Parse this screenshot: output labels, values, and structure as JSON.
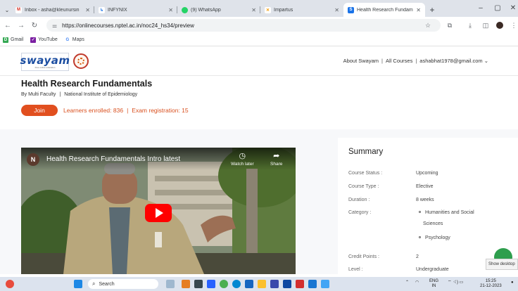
{
  "browser": {
    "tabs": [
      {
        "title": "Inbox - asha@kleunursin",
        "icon": "gmail-icon",
        "color": "#d93025",
        "glyph": "M"
      },
      {
        "title": "INFYNIX",
        "icon": "infynix-icon",
        "color": "#1a73e8",
        "glyph": "↳"
      },
      {
        "title": "(9) WhatsApp",
        "icon": "whatsapp-icon",
        "color": "#25d366",
        "glyph": "●"
      },
      {
        "title": "Impartus",
        "icon": "impartus-icon",
        "color": "#f4b400",
        "glyph": "✕"
      },
      {
        "title": "Health Research Fundam",
        "icon": "swayam-icon",
        "color": "#1a73e8",
        "glyph": "S",
        "active": true
      }
    ],
    "new_tab_label": "+",
    "url": "https://onlinecourses.nptel.ac.in/noc24_hs34/preview",
    "bookmarks": [
      {
        "label": "Gmail",
        "icon": "gmail-icon",
        "color": "#34a853",
        "glyph": "D"
      },
      {
        "label": "YouTube",
        "icon": "youtube-icon",
        "color": "#7b1fa2",
        "glyph": "✓"
      },
      {
        "label": "Maps",
        "icon": "maps-icon",
        "color": "#4285f4",
        "glyph": "G"
      }
    ]
  },
  "site": {
    "logo_text": "swayam",
    "logo_tagline": "Free online education",
    "nav": {
      "about": "About Swayam",
      "courses": "All Courses",
      "user": "ashabhat1978@gmail.com ⌄"
    }
  },
  "course": {
    "title": "Health Research Fundamentals",
    "faculty": "By Multi Faculty",
    "institute": "National Institute of Epidemiology",
    "join_label": "Join",
    "learners": "Learners enrolled: 836",
    "exam": "Exam registration: 15"
  },
  "video": {
    "channel_initial": "N",
    "title": "Health Research Fundamentals Intro latest",
    "watch_later": "Watch later",
    "share": "Share"
  },
  "summary": {
    "heading": "Summary",
    "rows": [
      {
        "label": "Course Status :",
        "value": "Upcoming"
      },
      {
        "label": "Course Type :",
        "value": "Elective"
      },
      {
        "label": "Duration :",
        "value": "8 weeks"
      },
      {
        "label": "Category :",
        "value": ""
      },
      {
        "label": "Credit Points :",
        "value": "2"
      },
      {
        "label": "Level :",
        "value": "Undergraduate"
      }
    ],
    "categories": [
      "Humanities and Social",
      "Sciences",
      "Psychology"
    ]
  },
  "tooltip": "Show desktop",
  "taskbar": {
    "search_placeholder": "Search",
    "lang_top": "ENG",
    "lang_bottom": "IN",
    "time": "15:25",
    "date": "21-12-2023"
  },
  "colors": {
    "accent": "#e14f1f",
    "brand_blue": "#1c4ea1",
    "chat_green": "#2e9e4d"
  }
}
